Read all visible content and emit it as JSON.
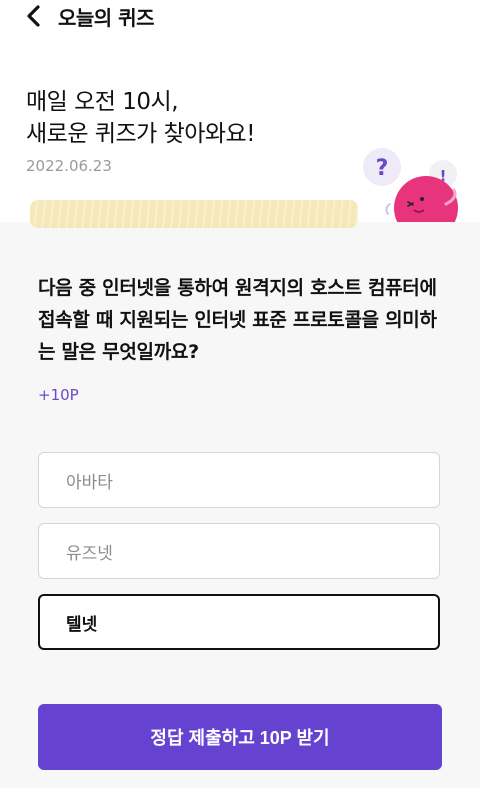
{
  "header": {
    "title": "오늘의 퀴즈",
    "back_icon": "chevron-left-icon"
  },
  "hero": {
    "headline": "매일 오전 10시,\n새로운 퀴즈가 찾아와요!",
    "date": "2022.06.23",
    "mascot": {
      "question_mark": "?",
      "exclaim_mark": "!"
    }
  },
  "quiz": {
    "question": "다음 중 인터넷을 통하여 원격지의 호스트 컴퓨터에 접속할 때 지원되는 인터넷 표준 프로토콜을 의미하는 말은 무엇일까요?",
    "points": "+10P",
    "options": [
      {
        "label": "아바타",
        "selected": false
      },
      {
        "label": "유즈넷",
        "selected": false
      },
      {
        "label": "텔넷",
        "selected": true
      }
    ],
    "submit_label": "정답 제출하고 10P 받기"
  },
  "colors": {
    "accent": "#6542d0",
    "points_text": "#6a4bc7",
    "panel_bg": "#f7f7f7",
    "highlight": "#f5e7b2",
    "mascot_body": "#e8347c"
  }
}
